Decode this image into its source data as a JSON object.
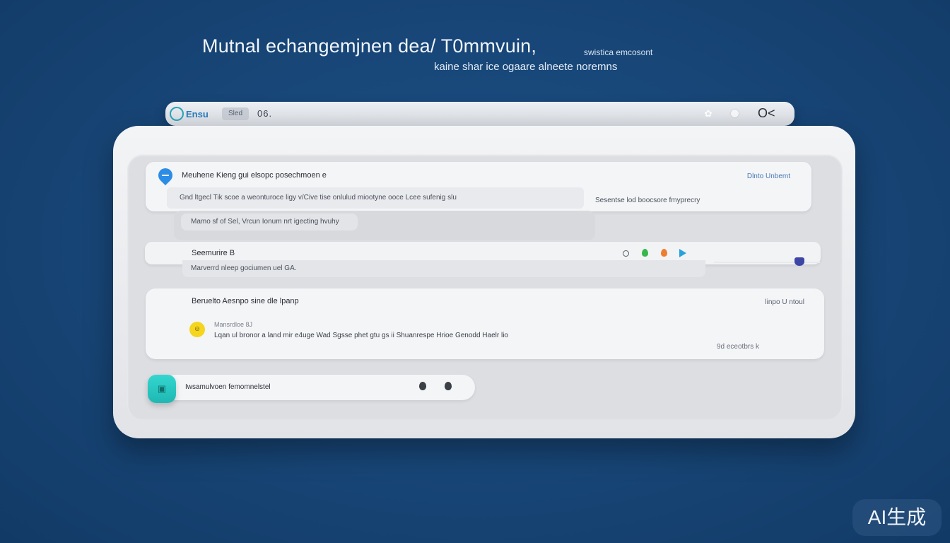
{
  "header": {
    "title": "Mutnal echangemjnen dea/ T0mmvuin,",
    "small_note": "swistica emcosont",
    "subtitle": "kaine shar ice ogaare alneete noremns"
  },
  "back_window": {
    "logo_text": "Ensu",
    "chip_label": "Sled",
    "value": "06.",
    "close_label": "O<"
  },
  "card1": {
    "title": "Meuhene Kieng gui elsopc posechmoen e",
    "tag": "Dlnto Unbemt",
    "line": "Gnd ltgecl Tik scoe a weonturoce ligy v/Cive tise onlulud miootyne ooce Lcee sufenig slu",
    "side": "Sesentse lod boocsore fmyprecry",
    "floating": "Mamo sf of Sel, Vrcun Ionum nrt igecting hvuhy"
  },
  "card2": {
    "title": "Seemurire B",
    "sub": "Marverrd nleep gociumen uel GA."
  },
  "card3": {
    "title": "Beruelto Aesnpo sine dle lpanp",
    "tag": "linpo U ntoul",
    "meta": "Mansrdloe 8J",
    "body": "Lqan ul bronor a land mir e4uge Wad Sgsse phet gtu gs ii Shuanrespe Hrioe Genodd Haelr lio",
    "foot": "9d eceotbrs k"
  },
  "bottom": {
    "text": "Iwsamulvoen femomnelstel"
  },
  "watermark": {
    "text": "AI生成"
  },
  "colors": {
    "background": "#174576",
    "accent_blue": "#2b8de6",
    "accent_teal": "#34d6cf",
    "status_green": "#36b84a",
    "status_orange": "#ee7d2e",
    "status_blue": "#27a2dc",
    "slider_handle": "#3d45a5",
    "emoji_yellow": "#f5d51e"
  },
  "icons": {
    "pin": "pin-icon",
    "gear": "gear-icon",
    "circle": "circle-icon",
    "close": "close-icon",
    "status_ring": "ring-icon",
    "status_green": "green-drop-icon",
    "status_orange": "orange-drop-icon",
    "play": "play-icon",
    "emoji": "emoji-icon",
    "app": "app-icon",
    "mic": "mic-icon"
  }
}
